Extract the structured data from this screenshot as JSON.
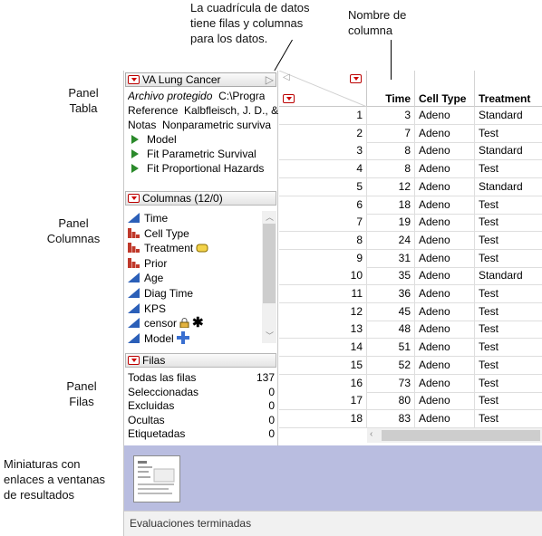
{
  "callouts": {
    "grid_note": "La cuadrícula de datos\ntiene filas y columnas\npara los datos.",
    "column_name": "Nombre de\ncolumna",
    "panel_tabla": "Panel\nTabla",
    "panel_columnas": "Panel\nColumnas",
    "panel_filas": "Panel\nFilas",
    "miniaturas": "Miniaturas con\nenlaces a ventanas\nde resultados"
  },
  "table_panel": {
    "title": "VA Lung Cancer",
    "props": [
      {
        "name": "Archivo protegido",
        "value": "C:\\Progra"
      },
      {
        "name": "Reference",
        "value": "Kalbfleisch, J. D., &"
      },
      {
        "name": "Notas",
        "value": "Nonparametric surviva"
      }
    ],
    "scripts": [
      "Model",
      "Fit Parametric Survival",
      "Fit Proportional Hazards"
    ]
  },
  "columns_panel": {
    "title": "Columnas (12/0)",
    "items": [
      {
        "label": "Time",
        "icon": "continuous-icon"
      },
      {
        "label": "Cell Type",
        "icon": "nominal-icon"
      },
      {
        "label": "Treatment",
        "icon": "nominal-icon"
      },
      {
        "label": "Prior",
        "icon": "nominal-icon"
      },
      {
        "label": "Age",
        "icon": "continuous-icon"
      },
      {
        "label": "Diag Time",
        "icon": "continuous-icon"
      },
      {
        "label": "KPS",
        "icon": "continuous-icon"
      },
      {
        "label": "censor",
        "icon": "continuous-icon"
      },
      {
        "label": "Model",
        "icon": "continuous-icon"
      }
    ]
  },
  "rows_panel": {
    "title": "Filas",
    "items": [
      {
        "label": "Todas las filas",
        "value": "137"
      },
      {
        "label": "Seleccionadas",
        "value": "0"
      },
      {
        "label": "Excluidas",
        "value": "0"
      },
      {
        "label": "Ocultas",
        "value": "0"
      },
      {
        "label": "Etiquetadas",
        "value": "0"
      }
    ]
  },
  "grid": {
    "headers": [
      "Time",
      "Cell Type",
      "Treatment"
    ],
    "rows": [
      [
        "1",
        "3",
        "Adeno",
        "Standard"
      ],
      [
        "2",
        "7",
        "Adeno",
        "Test"
      ],
      [
        "3",
        "8",
        "Adeno",
        "Standard"
      ],
      [
        "4",
        "8",
        "Adeno",
        "Test"
      ],
      [
        "5",
        "12",
        "Adeno",
        "Standard"
      ],
      [
        "6",
        "18",
        "Adeno",
        "Test"
      ],
      [
        "7",
        "19",
        "Adeno",
        "Test"
      ],
      [
        "8",
        "24",
        "Adeno",
        "Test"
      ],
      [
        "9",
        "31",
        "Adeno",
        "Test"
      ],
      [
        "10",
        "35",
        "Adeno",
        "Standard"
      ],
      [
        "11",
        "36",
        "Adeno",
        "Test"
      ],
      [
        "12",
        "45",
        "Adeno",
        "Test"
      ],
      [
        "13",
        "48",
        "Adeno",
        "Test"
      ],
      [
        "14",
        "51",
        "Adeno",
        "Test"
      ],
      [
        "15",
        "52",
        "Adeno",
        "Test"
      ],
      [
        "16",
        "73",
        "Adeno",
        "Test"
      ],
      [
        "17",
        "80",
        "Adeno",
        "Test"
      ],
      [
        "18",
        "83",
        "Adeno",
        "Test"
      ]
    ]
  },
  "status": "Evaluaciones terminadas",
  "colors": {
    "continuous": "#2b5fb8",
    "nominal": "#c0392b",
    "thumbs_bg": "#b9bde0"
  }
}
